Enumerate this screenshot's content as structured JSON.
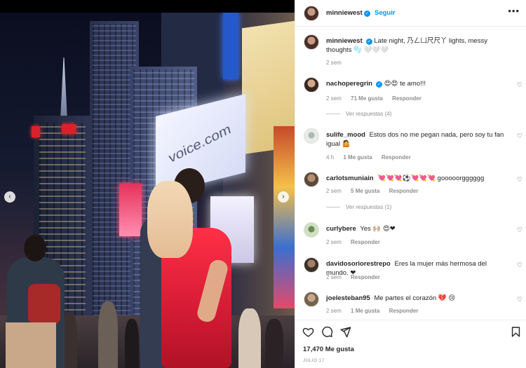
{
  "post": {
    "username": "minniewest",
    "follow_label": "Seguir",
    "caption_text": "Late night, 乃ㄥ凵尺尺丫 lights, messy thoughts 🫧 🤍🤍🤍",
    "caption_time": "2 sem",
    "photo_sign_text": "voice.com",
    "likes": "17,470 Me gusta",
    "date": "JULIO 17"
  },
  "comments": [
    {
      "username": "nachoperegrin",
      "verified": true,
      "text": "😍😍 te amo!!!",
      "time": "2 sem",
      "likes": "71 Me gusta",
      "reply": "Responder",
      "replies": "Ver respuestas (4)"
    },
    {
      "username": "sulife_mood",
      "text": "Estos dos no me pegan nada, pero soy tu fan igual 🤷",
      "time": "4 h",
      "likes": "1 Me gusta",
      "reply": "Responder"
    },
    {
      "username": "carlotsmuniain",
      "text": "💘💘💘⚽💘💘💘 gooooorgggggg",
      "time": "2 sem",
      "likes": "5 Me gusta",
      "reply": "Responder",
      "replies": "Ver respuestas (1)"
    },
    {
      "username": "curlybere",
      "text": "Yes 🙌🏼 😍❤",
      "time": "2 sem",
      "reply": "Responder"
    },
    {
      "username": "davidosoriorestrepo",
      "text": "Eres la mujer más hermosa del mundo. ❤",
      "time": "2 sem",
      "reply": "Responder"
    },
    {
      "username": "joelesteban95",
      "text": "Me partes el corazón 💔 😢",
      "time": "2 sem",
      "likes": "1 Me gusta",
      "reply": "Responder"
    }
  ],
  "icons": {
    "like": "heart-icon",
    "comment": "comment-icon",
    "share": "share-icon",
    "save": "bookmark-icon",
    "more": "more-options-icon",
    "prev": "chevron-left-icon",
    "next": "chevron-right-icon"
  },
  "colors": {
    "accent": "#0095f6",
    "text": "#262626",
    "secondary": "#8e8e8e"
  },
  "nav": {
    "prev_glyph": "‹",
    "next_glyph": "›",
    "more_glyph": "•••",
    "verified_glyph": "✓",
    "heart_glyph": "♡"
  }
}
